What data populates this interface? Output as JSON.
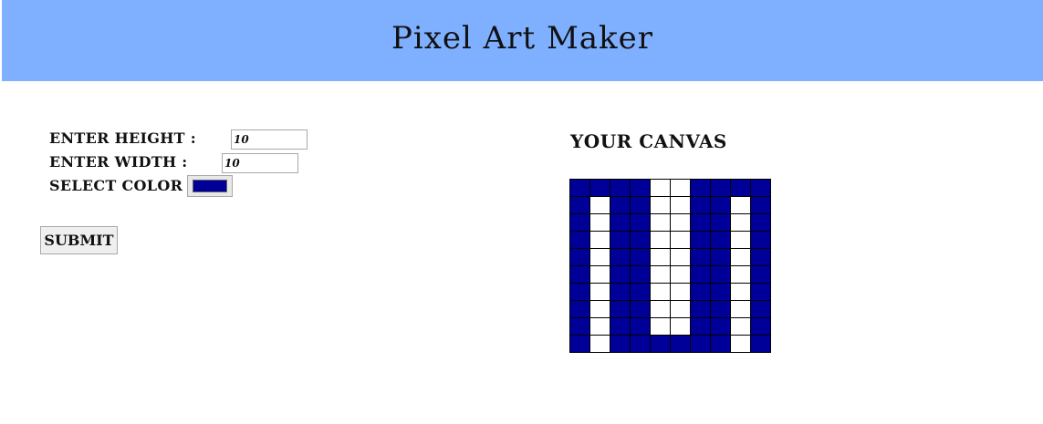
{
  "header": {
    "title": "Pixel Art Maker",
    "background": "#7fb0ff"
  },
  "form": {
    "height_label": "Enter Height :",
    "height_value": "10",
    "width_label": "Enter Width :",
    "width_value": "10",
    "color_label": "Select Color :",
    "color_value": "#000099",
    "submit_label": "Submit"
  },
  "canvas": {
    "title": "Your Canvas",
    "rows": 10,
    "cols": 10,
    "fill_color": "#000099",
    "empty_color": "#ffffff",
    "cells": [
      [
        1,
        1,
        1,
        1,
        0,
        0,
        1,
        1,
        1,
        1
      ],
      [
        1,
        0,
        1,
        1,
        0,
        0,
        1,
        1,
        0,
        1
      ],
      [
        1,
        0,
        1,
        1,
        0,
        0,
        1,
        1,
        0,
        1
      ],
      [
        1,
        0,
        1,
        1,
        0,
        0,
        1,
        1,
        0,
        1
      ],
      [
        1,
        0,
        1,
        1,
        0,
        0,
        1,
        1,
        0,
        1
      ],
      [
        1,
        0,
        1,
        1,
        0,
        0,
        1,
        1,
        0,
        1
      ],
      [
        1,
        0,
        1,
        1,
        0,
        0,
        1,
        1,
        0,
        1
      ],
      [
        1,
        0,
        1,
        1,
        0,
        0,
        1,
        1,
        0,
        1
      ],
      [
        1,
        0,
        1,
        1,
        0,
        0,
        1,
        1,
        0,
        1
      ],
      [
        1,
        0,
        1,
        1,
        1,
        1,
        1,
        1,
        0,
        1
      ]
    ]
  }
}
